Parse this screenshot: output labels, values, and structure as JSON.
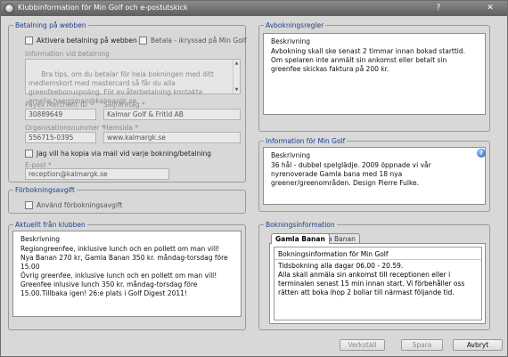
{
  "window": {
    "title": "Klubbinformation för Min Golf och e-postutskick",
    "help_glyph": "?",
    "close_glyph": "✕"
  },
  "betalning": {
    "title": "Betalning på webben",
    "aktivera_label": "Aktivera betalning på webben",
    "ikryssad_label": "Betala - ikryssad på Min Golf",
    "info_label": "Information vid betalning",
    "info_text": "Bra tips, om du betalar för hela bokningen med ditt medlemskort med mastercard så får du alla greenfeebonuspoäng. För ev.återbetalning kontakta emelie.haeggman@kalmargk.se",
    "payex_label": "Payex Merchant ID",
    "payex_value": "30889649",
    "saljforetag_label": "Säljföretag *",
    "saljforetag_value": "Kalmar Golf & Fritid AB",
    "orgnr_label": "Organisationsnummer *",
    "orgnr_value": "556715-0395",
    "hemsida_label": "Hemsida *",
    "hemsida_value": "www.kalmargk.se",
    "kopia_label": "Jag vill ha kopia via mail vid varje bokning/betalning",
    "epost_label": "E-post *",
    "epost_value": "reception@kalmargk.se"
  },
  "forbokning": {
    "title": "Förbokningsavgift",
    "anvand_label": "Använd förbokningsavgift"
  },
  "aktuellt": {
    "title": "Aktuellt från klubben",
    "head": "Beskrivning",
    "text": "Regiongreenfee, inklusive lunch och en pollett om man vill! Nya Banan 270 kr, Gamla Banan 350 kr. måndag-torsdag före 15.00\nÖvrig greenfee, inklusive lunch och en pollett om man vill! Greenfee inlusive lunch 350 kr. måndag-torsdag före 15.00.Tillbaka igen! 26:e plats i Golf Digest 2011!"
  },
  "avbokning": {
    "title": "Avbokningsregler",
    "head": "Beskrivning",
    "text": "Avbokning skall ske senast 2 timmar innan bokad starttid. Om spelaren inte anmält sin ankomst eller betalt sin greenfee skickas faktura på 200 kr."
  },
  "mingolf": {
    "title": "Information för Min Golf",
    "head": "Beskrivning",
    "text": "36 hål - dubbel spelglädje. 2009 öppnade vi vår nyrenoverade Gamla bana med 18 nya greener/greenområden. Design Pierre Fulke.",
    "help_glyph": "?"
  },
  "bokningsinfo": {
    "title": "Bokningsinformation",
    "tabs": [
      "Gamla Banan",
      "Nya Banan"
    ],
    "head": "Bokningsinformation för Min Golf",
    "text": "Tidsbokning alla dagar 06.00 - 20.59.\nAlla skall anmäla sin ankomst till receptionen eller i terminalen senast 15 min innan start. Vi förbehåller oss rätten att boka ihop 2 bollar till närmast följande tid."
  },
  "buttons": {
    "verkstall": "Verkställ",
    "spara": "Spara",
    "avbryt": "Avbryt"
  }
}
